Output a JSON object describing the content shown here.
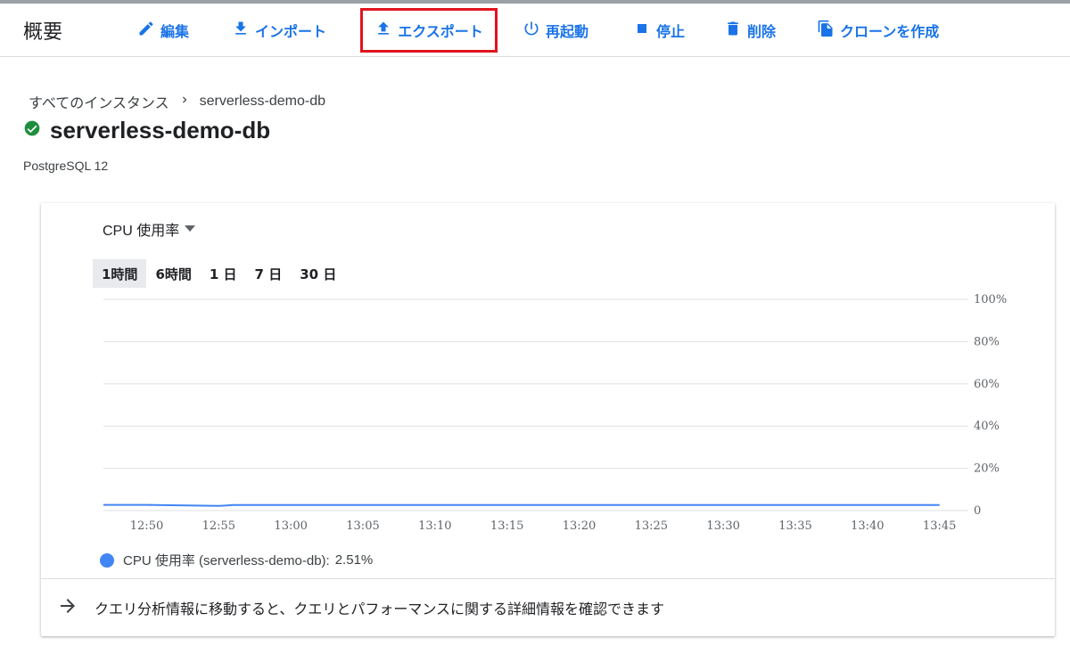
{
  "header": {
    "title": "概要",
    "actions": [
      {
        "label": "編集",
        "icon": "pencil-icon"
      },
      {
        "label": "インポート",
        "icon": "import-icon"
      },
      {
        "label": "エクスポート",
        "icon": "export-icon",
        "highlighted": true
      },
      {
        "label": "再起動",
        "icon": "power-icon"
      },
      {
        "label": "停止",
        "icon": "stop-icon"
      },
      {
        "label": "削除",
        "icon": "trash-icon"
      },
      {
        "label": "クローンを作成",
        "icon": "clone-icon"
      }
    ]
  },
  "breadcrumb": {
    "root": "すべてのインスタンス",
    "current": "serverless-demo-db"
  },
  "instance": {
    "name": "serverless-demo-db",
    "status_icon": "check-circle-icon",
    "status_color": "#1e8e3e",
    "version": "PostgreSQL 12"
  },
  "metric": {
    "selector_label": "CPU 使用率",
    "time_ranges": [
      "1時間",
      "6時間",
      "1 日",
      "7 日",
      "30 日"
    ],
    "active_range": "1時間"
  },
  "chart_data": {
    "type": "line",
    "x": [
      "12:47",
      "12:50",
      "12:55",
      "12:56",
      "13:00",
      "13:05",
      "13:10",
      "13:15",
      "13:20",
      "13:25",
      "13:30",
      "13:35",
      "13:40",
      "13:45"
    ],
    "xticks": [
      "12:50",
      "12:55",
      "13:00",
      "13:05",
      "13:10",
      "13:15",
      "13:20",
      "13:25",
      "13:30",
      "13:35",
      "13:40",
      "13:45"
    ],
    "series": [
      {
        "name": "CPU 使用率 (serverless-demo-db)",
        "color": "#4285f4",
        "values": [
          2.7,
          2.7,
          2.2,
          2.6,
          2.6,
          2.6,
          2.6,
          2.6,
          2.6,
          2.6,
          2.6,
          2.6,
          2.6,
          2.6
        ]
      }
    ],
    "yticks": [
      "0",
      "20%",
      "40%",
      "60%",
      "80%",
      "100%"
    ],
    "ylim": [
      0,
      100
    ],
    "grid": true,
    "y_axis_side": "right"
  },
  "legend": {
    "label": "CPU 使用率 (serverless-demo-db):",
    "value": "2.51%"
  },
  "footer": {
    "text": "クエリ分析情報に移動すると、クエリとパフォーマンスに関する詳細情報を確認できます"
  }
}
